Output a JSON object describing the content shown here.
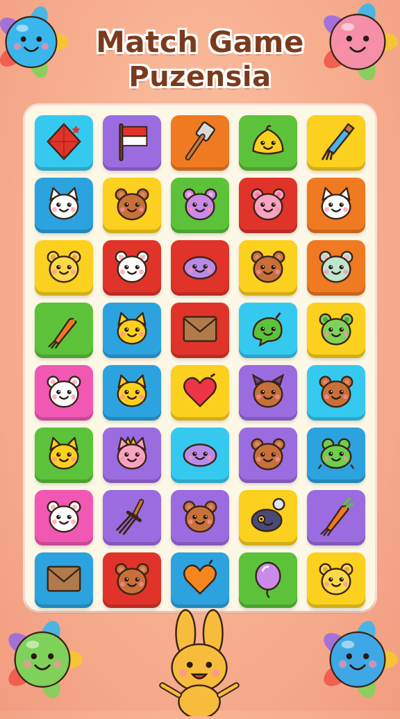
{
  "title": {
    "line1": "Match Game",
    "line2": "Puzensia"
  },
  "colors": {
    "cyan": "#36c9ef",
    "purple": "#9b6ce0",
    "orange": "#f07a22",
    "green": "#5cc23a",
    "yellow": "#fbd01e",
    "blue": "#2ca3df",
    "red": "#e0342b",
    "pink": "#f058b4"
  },
  "grid": [
    [
      {
        "icon": "red-gem-icon",
        "bg": "cyan"
      },
      {
        "icon": "flag-icon",
        "bg": "purple"
      },
      {
        "icon": "hammer-icon",
        "bg": "orange"
      },
      {
        "icon": "yellow-slime-icon",
        "bg": "green"
      },
      {
        "icon": "paintbrush-icon",
        "bg": "yellow"
      }
    ],
    [
      {
        "icon": "white-cat-icon",
        "bg": "blue"
      },
      {
        "icon": "brown-bear-icon",
        "bg": "yellow"
      },
      {
        "icon": "purple-bear-icon",
        "bg": "green"
      },
      {
        "icon": "pink-bear-icon",
        "bg": "red"
      },
      {
        "icon": "white-cat-icon",
        "bg": "orange"
      }
    ],
    [
      {
        "icon": "yellow-bear-icon",
        "bg": "yellow"
      },
      {
        "icon": "white-bear-icon",
        "bg": "red"
      },
      {
        "icon": "purple-blob-icon",
        "bg": "red"
      },
      {
        "icon": "brown-bear-icon",
        "bg": "yellow"
      },
      {
        "icon": "mint-bear-icon",
        "bg": "orange"
      }
    ],
    [
      {
        "icon": "carrot-icon",
        "bg": "green"
      },
      {
        "icon": "yellow-cat-icon",
        "bg": "blue"
      },
      {
        "icon": "envelope-icon",
        "bg": "red"
      },
      {
        "icon": "green-blob-icon",
        "bg": "cyan"
      },
      {
        "icon": "green-bear-icon",
        "bg": "yellow"
      }
    ],
    [
      {
        "icon": "white-bear-icon",
        "bg": "pink"
      },
      {
        "icon": "yellow-cat-icon",
        "bg": "blue"
      },
      {
        "icon": "heart-icon",
        "bg": "yellow"
      },
      {
        "icon": "brown-monster-icon",
        "bg": "purple"
      },
      {
        "icon": "brown-bear-icon",
        "bg": "cyan"
      }
    ],
    [
      {
        "icon": "yellow-cat-icon",
        "bg": "green"
      },
      {
        "icon": "pink-cat-icon",
        "bg": "purple"
      },
      {
        "icon": "purple-blob-icon",
        "bg": "cyan"
      },
      {
        "icon": "brown-bear-icon",
        "bg": "purple"
      },
      {
        "icon": "green-frog-icon",
        "bg": "blue"
      }
    ],
    [
      {
        "icon": "white-bear-icon",
        "bg": "pink"
      },
      {
        "icon": "fork-icon",
        "bg": "purple"
      },
      {
        "icon": "brown-bear-icon",
        "bg": "purple"
      },
      {
        "icon": "navy-blob-icon",
        "bg": "yellow"
      },
      {
        "icon": "carrot-icon",
        "bg": "purple"
      }
    ],
    [
      {
        "icon": "envelope-icon",
        "bg": "blue"
      },
      {
        "icon": "brown-bear-icon",
        "bg": "red"
      },
      {
        "icon": "orange-heart-icon",
        "bg": "blue"
      },
      {
        "icon": "purple-balloon-icon",
        "bg": "green"
      },
      {
        "icon": "yellow-bear-icon",
        "bg": "yellow"
      }
    ]
  ],
  "corners": [
    {
      "name": "blue-mascot-icon",
      "pos": "top-left",
      "color": "#3ab6ec"
    },
    {
      "name": "pink-mascot-icon",
      "pos": "top-right",
      "color": "#f58fa8"
    },
    {
      "name": "green-mascot-icon",
      "pos": "bottom-left",
      "color": "#7fd15a"
    },
    {
      "name": "bunny-mascot-icon",
      "pos": "bottom-center",
      "color": "#f7bc3b"
    },
    {
      "name": "blue-mascot-icon",
      "pos": "bottom-right",
      "color": "#3ea8e6"
    }
  ]
}
